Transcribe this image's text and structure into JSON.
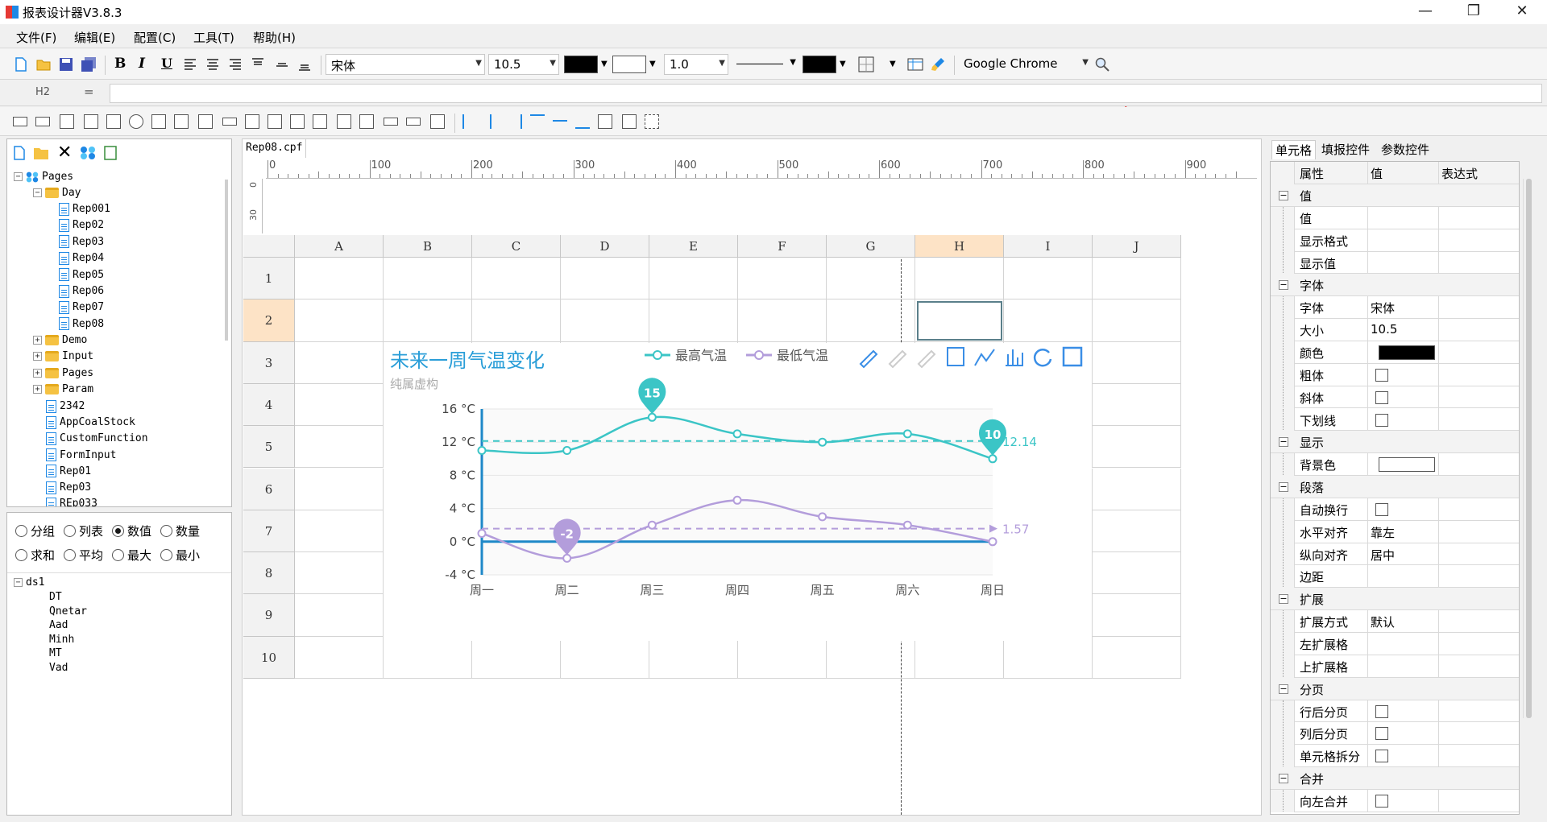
{
  "window": {
    "title": "报表设计器V3.8.3"
  },
  "menu": [
    "文件(F)",
    "编辑(E)",
    "配置(C)",
    "工具(T)",
    "帮助(H)"
  ],
  "toolbar": {
    "font": "宋体",
    "size": "10.5",
    "line_width": "1.0",
    "browser": "Google Chrome"
  },
  "formula": {
    "cell_ref": "H2",
    "eq": "=",
    "value": ""
  },
  "tree": {
    "root": "Pages",
    "day_folder": "Day",
    "day_items": [
      "Rep001",
      "Rep02",
      "Rep03",
      "Rep04",
      "Rep05",
      "Rep06",
      "Rep07",
      "Rep08"
    ],
    "folders": [
      "Demo",
      "Input",
      "Pages",
      "Param"
    ],
    "files": [
      "2342",
      "AppCoalStock",
      "CustomFunction",
      "FormInput",
      "Rep01",
      "Rep03",
      "REp033"
    ]
  },
  "options": {
    "row1": [
      "分组",
      "列表",
      "数值",
      "数量"
    ],
    "row2": [
      "求和",
      "平均",
      "最大",
      "最小"
    ],
    "selected": "数值"
  },
  "dataset": {
    "name": "ds1",
    "fields": [
      "DT",
      "Qnetar",
      "Aad",
      "Minh",
      "MT",
      "Vad"
    ]
  },
  "editor": {
    "tab": "Rep08.cpf",
    "ruler_h": [
      "0",
      "100",
      "200",
      "300",
      "400",
      "500",
      "600",
      "700",
      "800",
      "900"
    ],
    "ruler_v": [
      "0",
      "30"
    ],
    "columns": [
      "A",
      "B",
      "C",
      "D",
      "E",
      "F",
      "G",
      "H",
      "I",
      "J"
    ],
    "rows": [
      "1",
      "2",
      "3",
      "4",
      "5",
      "6",
      "7",
      "8",
      "9",
      "10"
    ]
  },
  "chart_data": {
    "type": "line",
    "title": "未来一周气温变化",
    "subtitle": "纯属虚构",
    "categories": [
      "周一",
      "周二",
      "周三",
      "周四",
      "周五",
      "周六",
      "周日"
    ],
    "ylim": [
      -4,
      16
    ],
    "y_ticks": [
      "16 °C",
      "12 °C",
      "8 °C",
      "4 °C",
      "0 °C",
      "-4 °C"
    ],
    "legend_position": "top",
    "series": [
      {
        "name": "最高气温",
        "color": "#3bc5c6",
        "values": [
          11,
          11,
          15,
          13,
          12,
          13,
          10
        ],
        "max_label": "15",
        "min_label": "10",
        "avg_label": "12.14",
        "avg": 12.14
      },
      {
        "name": "最低气温",
        "color": "#b39ddb",
        "values": [
          1,
          -2,
          2,
          5,
          3,
          2,
          0
        ],
        "min_label": "-2",
        "avg_label": "1.57",
        "avg": 1.57
      }
    ]
  },
  "props": {
    "tabs": [
      "单元格",
      "填报控件",
      "参数控件"
    ],
    "headers": [
      "属性",
      "值",
      "表达式"
    ],
    "rows": [
      {
        "group": true,
        "k": "值"
      },
      {
        "k": "值",
        "v": ""
      },
      {
        "k": "显示格式",
        "v": ""
      },
      {
        "k": "显示值",
        "v": ""
      },
      {
        "group": true,
        "k": "字体"
      },
      {
        "k": "字体",
        "v": "宋体"
      },
      {
        "k": "大小",
        "v": "10.5"
      },
      {
        "k": "颜色",
        "swatch": "#000000"
      },
      {
        "k": "粗体",
        "chk": true
      },
      {
        "k": "斜体",
        "chk": true
      },
      {
        "k": "下划线",
        "chk": true
      },
      {
        "group": true,
        "k": "显示"
      },
      {
        "k": "背景色",
        "swatch": "#ffffff"
      },
      {
        "group": true,
        "k": "段落"
      },
      {
        "k": "自动换行",
        "chk": true
      },
      {
        "k": "水平对齐",
        "v": "靠左"
      },
      {
        "k": "纵向对齐",
        "v": "居中"
      },
      {
        "k": "边距",
        "v": ""
      },
      {
        "group": true,
        "k": "扩展"
      },
      {
        "k": "扩展方式",
        "v": "默认"
      },
      {
        "k": "左扩展格",
        "v": ""
      },
      {
        "k": "上扩展格",
        "v": ""
      },
      {
        "group": true,
        "k": "分页"
      },
      {
        "k": "行后分页",
        "chk": true
      },
      {
        "k": "列后分页",
        "chk": true
      },
      {
        "k": "单元格拆分",
        "chk": true
      },
      {
        "group": true,
        "k": "合并"
      },
      {
        "k": "向左合并",
        "chk": true
      }
    ]
  }
}
